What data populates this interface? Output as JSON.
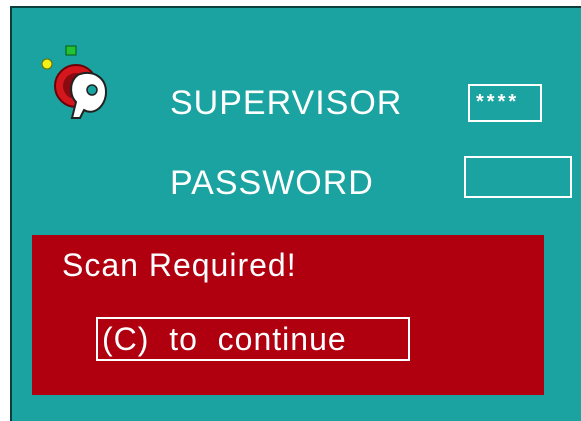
{
  "login": {
    "supervisor_label": "SUPERVISOR",
    "supervisor_value": "****",
    "password_label": "PASSWORD",
    "password_value": ""
  },
  "alert": {
    "message": "Scan Required!",
    "continue_label": "(C)  to  continue"
  },
  "icons": {
    "logo": "key-lock-icon"
  },
  "colors": {
    "background": "#1aa3a0",
    "alert_background": "#b0000f",
    "text": "#ffffff"
  }
}
